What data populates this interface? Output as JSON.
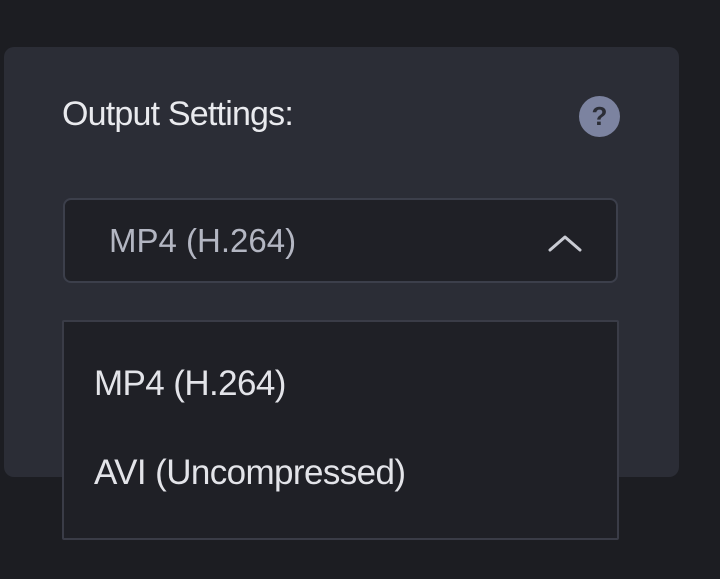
{
  "output_settings": {
    "title": "Output Settings:",
    "help_icon_glyph": "?",
    "help_icon": "question-circle-icon",
    "selected_value": "MP4 (H.264)",
    "chevron_icon": "chevron-up-icon",
    "dropdown_open": true,
    "options": [
      {
        "label": "MP4 (H.264)"
      },
      {
        "label": "AVI (Uncompressed)"
      }
    ]
  },
  "colors": {
    "background": "#1c1d22",
    "panel": "#2b2d36",
    "help_icon": "#7c83a0",
    "select_bg": "#1f2026",
    "text_primary": "#e9eaee",
    "text_muted": "#b3b6c2"
  }
}
